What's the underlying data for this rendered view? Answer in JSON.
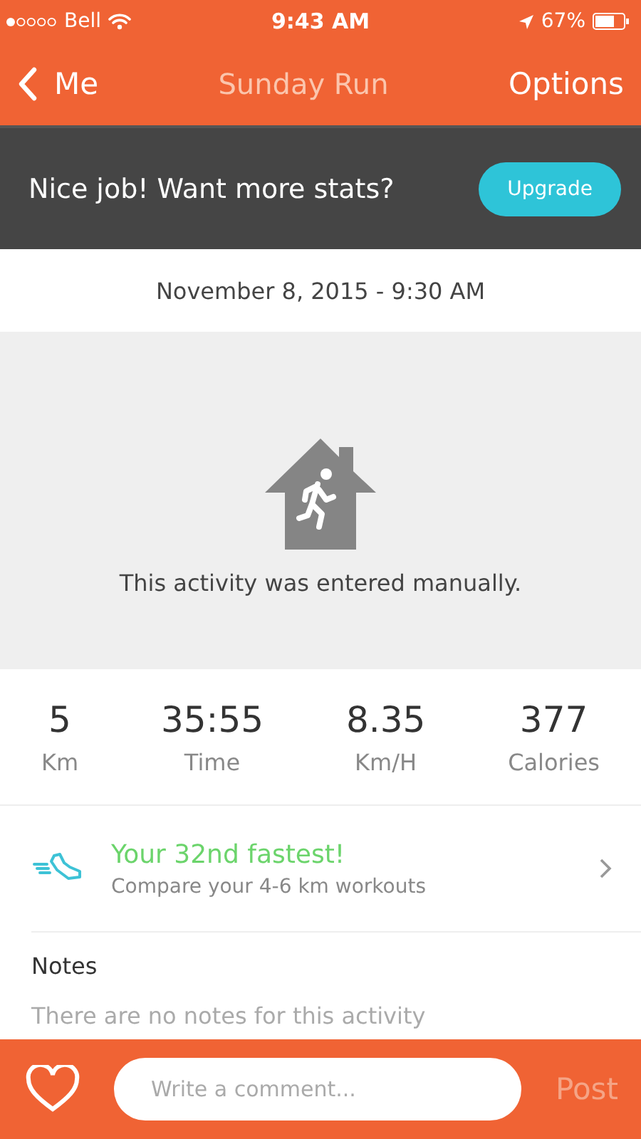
{
  "status_bar": {
    "carrier": "Bell",
    "time": "9:43 AM",
    "battery": "67%"
  },
  "nav": {
    "back": "Me",
    "title": "Sunday Run",
    "action": "Options"
  },
  "banner": {
    "text": "Nice job! Want more stats?",
    "button": "Upgrade"
  },
  "date": "November 8, 2015 - 9:30 AM",
  "manual_entry": {
    "message": "This activity was entered manually."
  },
  "stats": [
    {
      "value": "5",
      "label": "Km"
    },
    {
      "value": "35:55",
      "label": "Time"
    },
    {
      "value": "8.35",
      "label": "Km/H"
    },
    {
      "value": "377",
      "label": "Calories"
    }
  ],
  "ranking": {
    "title": "Your 32nd fastest!",
    "subtitle": "Compare your 4-6 km workouts"
  },
  "notes": {
    "heading": "Notes",
    "text": "There are no notes for this activity"
  },
  "footer": {
    "liked": false,
    "placeholder": "Write a comment...",
    "post": "Post",
    "post_disabled": true
  }
}
